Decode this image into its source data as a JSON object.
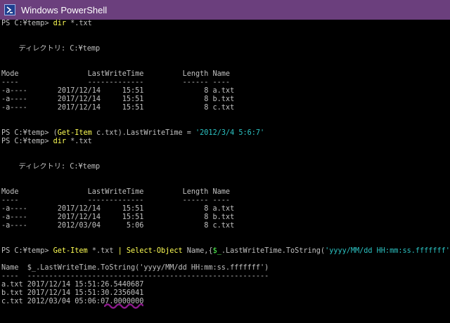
{
  "window": {
    "title": "Windows PowerShell",
    "icon": "powershell-icon",
    "titlebar_color": "#6b3f7d",
    "background_color": "#000000"
  },
  "colors": {
    "text": "#c0c0c0",
    "command": "#ffff55",
    "string": "#2cc4c4",
    "variable": "#55ff55",
    "annotation": "#8b1a8b"
  },
  "console": {
    "lines": [
      [
        {
          "t": "PS C:¥temp> ",
          "c": "param"
        },
        {
          "t": "dir",
          "c": "cmd"
        },
        {
          "t": " *.txt",
          "c": "param"
        }
      ],
      [],
      [],
      [
        {
          "t": "    ディレクトリ: C:¥temp",
          "c": "param"
        }
      ],
      [],
      [],
      [
        {
          "t": "Mode                LastWriteTime         Length Name",
          "c": "param"
        }
      ],
      [
        {
          "t": "----                -------------         ------ ----",
          "c": "param"
        }
      ],
      [
        {
          "t": "-a----       2017/12/14     15:51              8 a.txt",
          "c": "param"
        }
      ],
      [
        {
          "t": "-a----       2017/12/14     15:51              8 b.txt",
          "c": "param"
        }
      ],
      [
        {
          "t": "-a----       2017/12/14     15:51              8 c.txt",
          "c": "param"
        }
      ],
      [],
      [],
      [
        {
          "t": "PS C:¥temp> ",
          "c": "param"
        },
        {
          "t": "(",
          "c": "param"
        },
        {
          "t": "Get-Item",
          "c": "cmd"
        },
        {
          "t": " c.txt).LastWriteTime = ",
          "c": "param"
        },
        {
          "t": "'2012/3/4 5:6:7'",
          "c": "str"
        }
      ],
      [
        {
          "t": "PS C:¥temp> ",
          "c": "param"
        },
        {
          "t": "dir",
          "c": "cmd"
        },
        {
          "t": " *.txt",
          "c": "param"
        }
      ],
      [],
      [],
      [
        {
          "t": "    ディレクトリ: C:¥temp",
          "c": "param"
        }
      ],
      [],
      [],
      [
        {
          "t": "Mode                LastWriteTime         Length Name",
          "c": "param"
        }
      ],
      [
        {
          "t": "----                -------------         ------ ----",
          "c": "param"
        }
      ],
      [
        {
          "t": "-a----       2017/12/14     15:51              8 a.txt",
          "c": "param"
        }
      ],
      [
        {
          "t": "-a----       2017/12/14     15:51              8 b.txt",
          "c": "param"
        }
      ],
      [
        {
          "t": "-a----       2012/03/04      5:06              8 c.txt",
          "c": "param"
        }
      ],
      [],
      [],
      [
        {
          "t": "PS C:¥temp> ",
          "c": "param"
        },
        {
          "t": "Get-Item",
          "c": "cmd"
        },
        {
          "t": " *.txt ",
          "c": "param"
        },
        {
          "t": "|",
          "c": "sep"
        },
        {
          "t": " ",
          "c": "param"
        },
        {
          "t": "Select-Object",
          "c": "cmd"
        },
        {
          "t": " Name,{",
          "c": "param"
        },
        {
          "t": "$_",
          "c": "var"
        },
        {
          "t": ".LastWriteTime.ToString(",
          "c": "param"
        },
        {
          "t": "'yyyy/MM/dd HH:mm:ss.fffffff'",
          "c": "str"
        },
        {
          "t": ")}",
          "c": "param"
        }
      ],
      [],
      [
        {
          "t": "Name  $_.LastWriteTime.ToString('yyyy/MM/dd HH:mm:ss.fffffff')",
          "c": "param"
        }
      ],
      [
        {
          "t": "----  --------------------------------------------------------",
          "c": "param"
        }
      ],
      [
        {
          "t": "a.txt 2017/12/14 15:51:26.5440687",
          "c": "param"
        }
      ],
      [
        {
          "t": "b.txt 2017/12/14 15:51:30.2356041",
          "c": "param"
        }
      ],
      [
        {
          "t": "c.txt 2012/03/04 05:06:07.0000000",
          "c": "param"
        }
      ]
    ]
  }
}
